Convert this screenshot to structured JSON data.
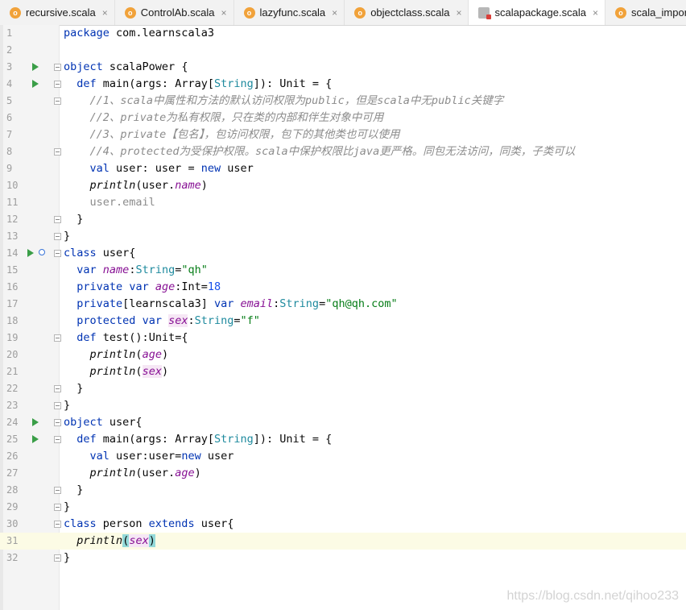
{
  "tabs": [
    {
      "label": "recursive.scala",
      "icon": "scala-object-icon",
      "active": false
    },
    {
      "label": "ControlAb.scala",
      "icon": "scala-object-icon",
      "active": false
    },
    {
      "label": "lazyfunc.scala",
      "icon": "scala-object-icon",
      "active": false
    },
    {
      "label": "objectclass.scala",
      "icon": "scala-object-icon",
      "active": false
    },
    {
      "label": "scalapackage.scala",
      "icon": "scala-package-icon",
      "active": true
    },
    {
      "label": "scala_import.scala",
      "icon": "scala-object-icon",
      "active": false
    }
  ],
  "tab_close_glyph": "×",
  "line_numbers": [
    "1",
    "2",
    "3",
    "4",
    "5",
    "6",
    "7",
    "8",
    "9",
    "10",
    "11",
    "12",
    "13",
    "14",
    "15",
    "16",
    "17",
    "18",
    "19",
    "20",
    "21",
    "22",
    "23",
    "24",
    "25",
    "26",
    "27",
    "28",
    "29",
    "30",
    "31",
    "32"
  ],
  "current_line": 31,
  "code": {
    "l1": [
      "package",
      " com.learnscala3"
    ],
    "l3": [
      "object",
      " scalaPower {"
    ],
    "l4": [
      "  ",
      "def",
      " main(args: ",
      "Array",
      "[",
      "String",
      "]): ",
      "Unit",
      " = {"
    ],
    "l5": "    //1、scala中属性和方法的默认访问权限为public，但是scala中无public关键字",
    "l6": "    //2、private为私有权限，只在类的内部和伴生对象中可用",
    "l7": "    //3、private【包名】，包访问权限，包下的其他类也可以使用",
    "l8": "    //4、protected为受保护权限。scala中保护权限比java更严格。同包无法访问，同类，子类可以",
    "l9": [
      "    ",
      "val",
      " user: user = ",
      "new",
      " user"
    ],
    "l10": [
      "    ",
      "println",
      "(user.",
      "name",
      ")"
    ],
    "l11": "    user.email",
    "l12": "  }",
    "l13": "}",
    "l14": [
      "class",
      " user{"
    ],
    "l15": [
      "  ",
      "var",
      " ",
      "name",
      ":",
      "String",
      "=",
      "\"qh\""
    ],
    "l16": [
      "  ",
      "private",
      " ",
      "var",
      " ",
      "age",
      ":",
      "Int",
      "=",
      "18"
    ],
    "l17": [
      "  ",
      "private",
      "[learnscala3] ",
      "var",
      " ",
      "email",
      ":",
      "String",
      "=",
      "\"qh@qh.com\""
    ],
    "l18": [
      "  ",
      "protected",
      " ",
      "var",
      " ",
      "sex",
      ":",
      "String",
      "=",
      "\"f\""
    ],
    "l19": [
      "  ",
      "def",
      " test():",
      "Unit",
      "={"
    ],
    "l20": [
      "    ",
      "println",
      "(",
      "age",
      ")"
    ],
    "l21": [
      "    ",
      "println",
      "(",
      "sex",
      ")"
    ],
    "l22": "  }",
    "l23": "}",
    "l24": [
      "object",
      " user{"
    ],
    "l25": [
      "  ",
      "def",
      " main(args: ",
      "Array",
      "[",
      "String",
      "]): ",
      "Unit",
      " = {"
    ],
    "l26": [
      "    ",
      "val",
      " user:user=",
      "new",
      " user"
    ],
    "l27": [
      "    ",
      "println",
      "(user.",
      "age",
      ")"
    ],
    "l28": "  }",
    "l29": "}",
    "l30": [
      "class",
      " person ",
      "extends",
      " user{"
    ],
    "l31": [
      "  ",
      "println",
      "(",
      "sex",
      ")"
    ],
    "l32": "}"
  },
  "colors": {
    "keyword": "#0033b3",
    "type": "#1e8a9e",
    "string": "#067d17",
    "number": "#1750eb",
    "comment": "#8c8c8c",
    "field": "#871094",
    "run_gutter": "#3a9e47",
    "current_line_bg": "#fcfbe5"
  },
  "watermark": "https://blog.csdn.net/qihoo233"
}
